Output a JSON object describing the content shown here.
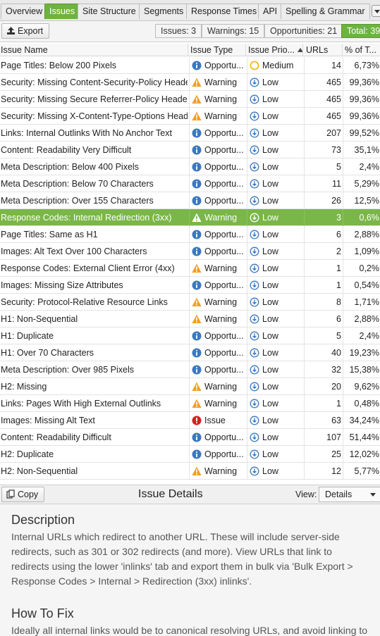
{
  "tabs": [
    {
      "label": "Overview",
      "active": false
    },
    {
      "label": "Issues",
      "active": true
    },
    {
      "label": "Site Structure",
      "active": false
    },
    {
      "label": "Segments",
      "active": false
    },
    {
      "label": "Response Times",
      "active": false
    },
    {
      "label": "API",
      "active": false
    },
    {
      "label": "Spelling & Grammar",
      "active": false
    }
  ],
  "toolbar": {
    "export_label": "Export",
    "issues_label": "Issues: 3",
    "warnings_label": "Warnings: 15",
    "opportunities_label": "Opportunities: 21",
    "total_label": "Total: 39"
  },
  "columns": {
    "name": "Issue Name",
    "type": "Issue Type",
    "priority": "Issue Prio...",
    "urls": "URLs",
    "pct": "% of T..."
  },
  "colors": {
    "accent_green": "#6db33f",
    "warning": "#f0a020",
    "info": "#3a78c2",
    "issue": "#d92020",
    "medium": "#f0b400"
  },
  "rows": [
    {
      "name": "Page Titles: Below 200 Pixels",
      "type": "Opportu...",
      "type_icon": "info-icon",
      "priority": "Medium",
      "prio_icon": "medium-circle-icon",
      "urls": "14",
      "pct": "6,73%"
    },
    {
      "name": "Security: Missing Content-Security-Policy Header",
      "type": "Warning",
      "type_icon": "warning-icon",
      "priority": "Low",
      "prio_icon": "low-arrow-icon",
      "urls": "465",
      "pct": "99,36%"
    },
    {
      "name": "Security: Missing Secure Referrer-Policy Header",
      "type": "Warning",
      "type_icon": "warning-icon",
      "priority": "Low",
      "prio_icon": "low-arrow-icon",
      "urls": "465",
      "pct": "99,36%"
    },
    {
      "name": "Security: Missing X-Content-Type-Options Header",
      "type": "Warning",
      "type_icon": "warning-icon",
      "priority": "Low",
      "prio_icon": "low-arrow-icon",
      "urls": "465",
      "pct": "99,36%"
    },
    {
      "name": "Links: Internal Outlinks With No Anchor Text",
      "type": "Opportu...",
      "type_icon": "info-icon",
      "priority": "Low",
      "prio_icon": "low-arrow-icon",
      "urls": "207",
      "pct": "99,52%"
    },
    {
      "name": "Content: Readability Very Difficult",
      "type": "Opportu...",
      "type_icon": "info-icon",
      "priority": "Low",
      "prio_icon": "low-arrow-icon",
      "urls": "73",
      "pct": "35,1%"
    },
    {
      "name": "Meta Description: Below 400 Pixels",
      "type": "Opportu...",
      "type_icon": "info-icon",
      "priority": "Low",
      "prio_icon": "low-arrow-icon",
      "urls": "5",
      "pct": "2,4%"
    },
    {
      "name": "Meta Description: Below 70 Characters",
      "type": "Opportu...",
      "type_icon": "info-icon",
      "priority": "Low",
      "prio_icon": "low-arrow-icon",
      "urls": "11",
      "pct": "5,29%"
    },
    {
      "name": "Meta Description: Over 155 Characters",
      "type": "Opportu...",
      "type_icon": "info-icon",
      "priority": "Low",
      "prio_icon": "low-arrow-icon",
      "urls": "26",
      "pct": "12,5%"
    },
    {
      "name": "Response Codes: Internal Redirection (3xx)",
      "type": "Warning",
      "type_icon": "warning-icon",
      "priority": "Low",
      "prio_icon": "low-arrow-icon",
      "urls": "3",
      "pct": "0,6%",
      "selected": true
    },
    {
      "name": "Page Titles: Same as H1",
      "type": "Opportu...",
      "type_icon": "info-icon",
      "priority": "Low",
      "prio_icon": "low-arrow-icon",
      "urls": "6",
      "pct": "2,88%"
    },
    {
      "name": "Images: Alt Text Over 100 Characters",
      "type": "Opportu...",
      "type_icon": "info-icon",
      "priority": "Low",
      "prio_icon": "low-arrow-icon",
      "urls": "2",
      "pct": "1,09%"
    },
    {
      "name": "Response Codes: External Client Error (4xx)",
      "type": "Warning",
      "type_icon": "warning-icon",
      "priority": "Low",
      "prio_icon": "low-arrow-icon",
      "urls": "1",
      "pct": "0,2%"
    },
    {
      "name": "Images: Missing Size Attributes",
      "type": "Opportu...",
      "type_icon": "info-icon",
      "priority": "Low",
      "prio_icon": "low-arrow-icon",
      "urls": "1",
      "pct": "0,54%"
    },
    {
      "name": "Security: Protocol-Relative Resource Links",
      "type": "Warning",
      "type_icon": "warning-icon",
      "priority": "Low",
      "prio_icon": "low-arrow-icon",
      "urls": "8",
      "pct": "1,71%"
    },
    {
      "name": "H1: Non-Sequential",
      "type": "Warning",
      "type_icon": "warning-icon",
      "priority": "Low",
      "prio_icon": "low-arrow-icon",
      "urls": "6",
      "pct": "2,88%"
    },
    {
      "name": "H1: Duplicate",
      "type": "Opportu...",
      "type_icon": "info-icon",
      "priority": "Low",
      "prio_icon": "low-arrow-icon",
      "urls": "5",
      "pct": "2,4%"
    },
    {
      "name": "H1: Over 70 Characters",
      "type": "Opportu...",
      "type_icon": "info-icon",
      "priority": "Low",
      "prio_icon": "low-arrow-icon",
      "urls": "40",
      "pct": "19,23%"
    },
    {
      "name": "Meta Description: Over 985 Pixels",
      "type": "Opportu...",
      "type_icon": "info-icon",
      "priority": "Low",
      "prio_icon": "low-arrow-icon",
      "urls": "32",
      "pct": "15,38%"
    },
    {
      "name": "H2: Missing",
      "type": "Warning",
      "type_icon": "warning-icon",
      "priority": "Low",
      "prio_icon": "low-arrow-icon",
      "urls": "20",
      "pct": "9,62%"
    },
    {
      "name": "Links: Pages With High External Outlinks",
      "type": "Warning",
      "type_icon": "warning-icon",
      "priority": "Low",
      "prio_icon": "low-arrow-icon",
      "urls": "1",
      "pct": "0,48%"
    },
    {
      "name": "Images: Missing Alt Text",
      "type": "Issue",
      "type_icon": "issue-icon",
      "priority": "Low",
      "prio_icon": "low-arrow-icon",
      "urls": "63",
      "pct": "34,24%"
    },
    {
      "name": "Content: Readability Difficult",
      "type": "Opportu...",
      "type_icon": "info-icon",
      "priority": "Low",
      "prio_icon": "low-arrow-icon",
      "urls": "107",
      "pct": "51,44%"
    },
    {
      "name": "H2: Duplicate",
      "type": "Opportu...",
      "type_icon": "info-icon",
      "priority": "Low",
      "prio_icon": "low-arrow-icon",
      "urls": "25",
      "pct": "12,02%"
    },
    {
      "name": "H2: Non-Sequential",
      "type": "Warning",
      "type_icon": "warning-icon",
      "priority": "Low",
      "prio_icon": "low-arrow-icon",
      "urls": "12",
      "pct": "5,77%"
    }
  ],
  "details": {
    "copy_label": "Copy",
    "title": "Issue Details",
    "view_label": "View:",
    "view_value": "Details",
    "description_heading": "Description",
    "description_text": "Internal URLs which redirect to another URL. These will include server-side redirects, such as 301 or 302 redirects (and more). View URLs that link to redirects using the lower 'inlinks' tab and export them in bulk via 'Bulk Export > Response Codes > Internal > Redirection (3xx) inlinks'.",
    "howto_heading": "How To Fix",
    "howto_text": "Ideally all internal links would be to canonical resolving URLs, and avoid linking to"
  }
}
